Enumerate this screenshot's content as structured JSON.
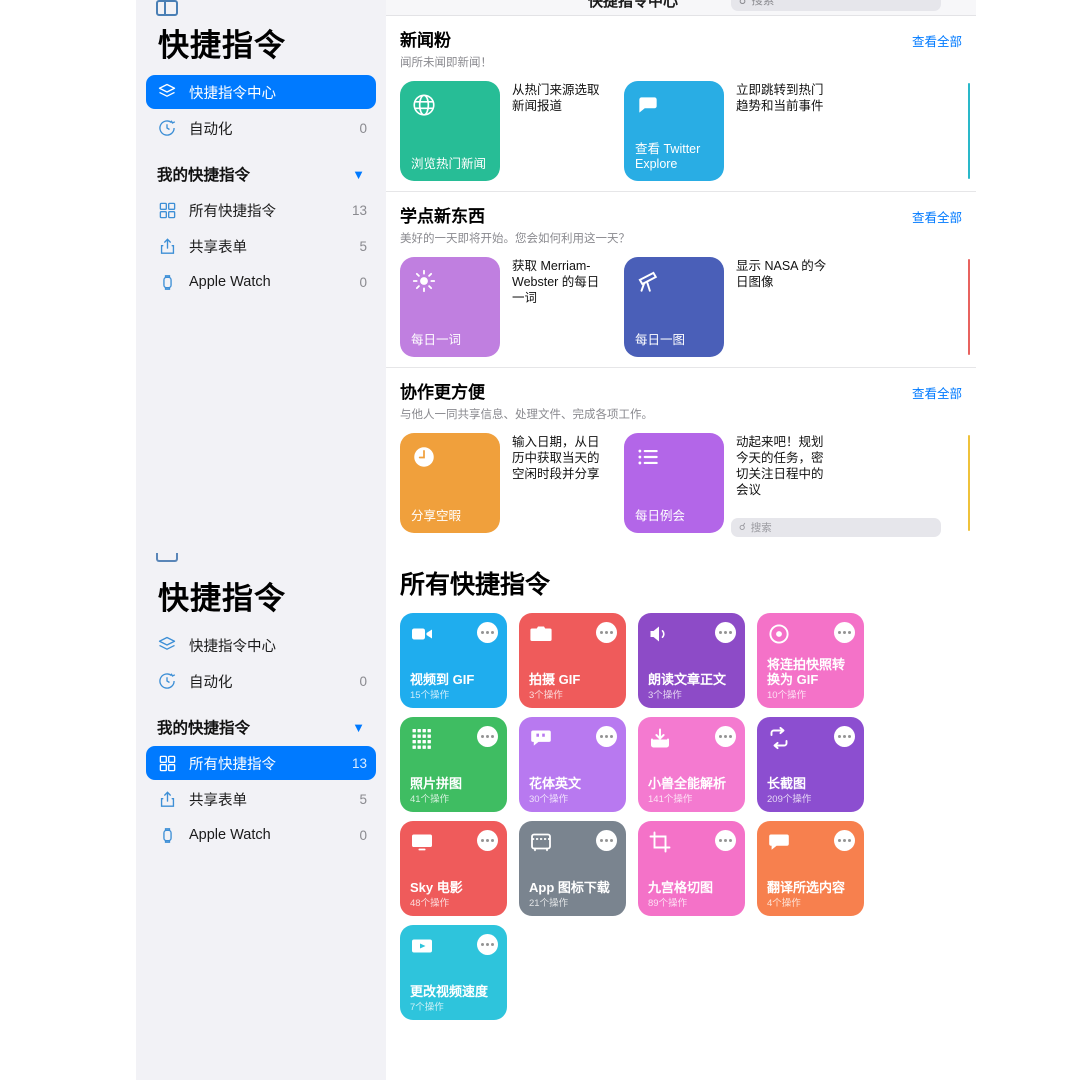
{
  "app": {
    "title": "快捷指令",
    "topbar_title": "快捷指令中心",
    "search_placeholder": "搜索",
    "accent": "#007aff",
    "sidebar_bg": "#f2f2f6"
  },
  "sidebar": {
    "title": "快捷指令",
    "primary": [
      {
        "label": "快捷指令中心",
        "count": "",
        "icon": "shortcuts-gallery-icon",
        "active": true
      },
      {
        "label": "自动化",
        "count": "0",
        "icon": "automation-clock-icon",
        "active": false
      }
    ],
    "group": {
      "label": "我的快捷指令",
      "chevron": "chevron-down-icon"
    },
    "items": [
      {
        "label": "所有快捷指令",
        "count": "13",
        "icon": "grid-squares-icon",
        "active": false
      },
      {
        "label": "共享表单",
        "count": "5",
        "icon": "share-box-icon",
        "active": false
      },
      {
        "label": "Apple Watch",
        "count": "0",
        "icon": "apple-watch-icon",
        "active": false
      }
    ]
  },
  "sidebar_bottom": {
    "title": "快捷指令",
    "primary": [
      {
        "label": "快捷指令中心",
        "count": "",
        "icon": "shortcuts-gallery-icon",
        "active": false
      },
      {
        "label": "自动化",
        "count": "0",
        "icon": "automation-clock-icon",
        "active": false
      }
    ],
    "group": {
      "label": "我的快捷指令",
      "chevron": "chevron-down-icon"
    },
    "items": [
      {
        "label": "所有快捷指令",
        "count": "13",
        "icon": "grid-squares-icon",
        "active": true
      },
      {
        "label": "共享表单",
        "count": "5",
        "icon": "share-box-icon",
        "active": false
      },
      {
        "label": "Apple Watch",
        "count": "0",
        "icon": "apple-watch-icon",
        "active": false
      }
    ]
  },
  "gallery": {
    "see_all_label": "查看全部",
    "sections": [
      {
        "title": "新闻粉",
        "subtitle": "闻所未闻即新闻！",
        "cards": [
          {
            "name": "浏览热门新闻",
            "desc": "从热门来源选取新闻报道",
            "color": "#27bd96",
            "icon": "globe-icon"
          },
          {
            "name": "查看 Twitter Explore",
            "desc": "立即跳转到热门趋势和当前事件",
            "color": "#29ade4",
            "icon": "speech-bubble-icon"
          }
        ],
        "edge_color": "#2ab8c9"
      },
      {
        "title": "学点新东西",
        "subtitle": "美好的一天即将开始。您会如何利用这一天？",
        "cards": [
          {
            "name": "每日一词",
            "desc": "获取 Merriam-Webster 的每日一词",
            "color": "#c07fe0",
            "icon": "sun-icon"
          },
          {
            "name": "每日一图",
            "desc": "显示 NASA 的今日图像",
            "color": "#4a5fb8",
            "icon": "telescope-icon"
          }
        ],
        "edge_color": "#e8635f"
      },
      {
        "title": "协作更方便",
        "subtitle": "与他人一同共享信息、处理文件、完成各项工作。",
        "cards": [
          {
            "name": "分享空暇",
            "desc": "输入日期，从日历中获取当天的空闲时段并分享",
            "color": "#f0a03c",
            "icon": "clock-icon"
          },
          {
            "name": "每日例会",
            "desc": "动起来吧！规划今天的任务，密切关注日程中的会议",
            "color": "#b366e8",
            "icon": "list-bullet-icon"
          }
        ],
        "edge_color": "#efc23b"
      }
    ]
  },
  "library": {
    "title": "所有快捷指令",
    "actions_suffix": "个操作",
    "more_icon": "ellipsis-icon",
    "shortcuts": [
      {
        "name": "视频到 GIF",
        "actions": "15个操作",
        "color": "#1fadee",
        "icon": "video-camera-icon"
      },
      {
        "name": "拍摄 GIF",
        "actions": "3个操作",
        "color": "#ef5b5b",
        "icon": "camera-icon"
      },
      {
        "name": "朗读文章正文",
        "actions": "3个操作",
        "color": "#8d4bc7",
        "icon": "speaker-icon"
      },
      {
        "name": "将连拍快照转换为 GIF",
        "actions": "10个操作",
        "color": "#f472c8",
        "icon": "record-circle-icon"
      },
      {
        "name": "照片拼图",
        "actions": "41个操作",
        "color": "#3fbd62",
        "icon": "dot-grid-icon"
      },
      {
        "name": "花体英文",
        "actions": "30个操作",
        "color": "#b879f0",
        "icon": "quote-bubble-icon"
      },
      {
        "name": "小兽全能解析",
        "actions": "141个操作",
        "color": "#f47ad0",
        "icon": "download-tray-icon"
      },
      {
        "name": "长截图",
        "actions": "209个操作",
        "color": "#8c4ed0",
        "icon": "repeat-arrows-icon"
      },
      {
        "name": "Sky 电影",
        "actions": "48个操作",
        "color": "#ef5b5b",
        "icon": "monitor-icon"
      },
      {
        "name": "App 图标下载",
        "actions": "21个操作",
        "color": "#7a848f",
        "icon": "app-window-icon"
      },
      {
        "name": "九宫格切图",
        "actions": "89个操作",
        "color": "#f472c8",
        "icon": "crop-icon"
      },
      {
        "name": "翻译所选内容",
        "actions": "4个操作",
        "color": "#f7804e",
        "icon": "chat-bubble-icon"
      },
      {
        "name": "更改视频速度",
        "actions": "7个操作",
        "color": "#2ec4dc",
        "icon": "play-video-icon"
      }
    ]
  },
  "seam": {
    "search_placeholder": "搜索"
  }
}
